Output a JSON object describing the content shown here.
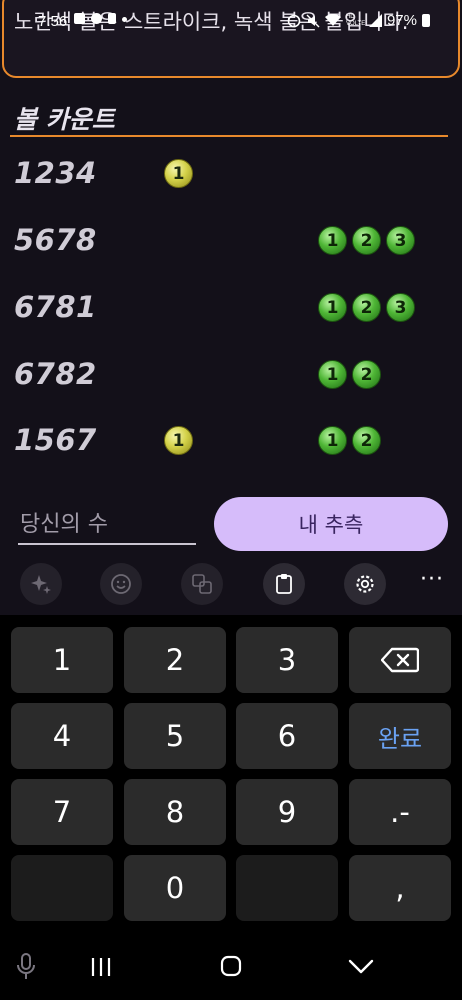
{
  "status_bar": {
    "time": "7:56",
    "signal_text": "HD VOLTE",
    "battery": "97%"
  },
  "hint": {
    "text": "노란색 볼은 스트라이크, 녹색 볼은 볼입니다."
  },
  "section": {
    "title": "볼 카운트"
  },
  "rows": [
    {
      "number": "1234",
      "yellow": [
        "1"
      ],
      "green": []
    },
    {
      "number": "5678",
      "yellow": [],
      "green": [
        "1",
        "2",
        "3"
      ]
    },
    {
      "number": "6781",
      "yellow": [],
      "green": [
        "1",
        "2",
        "3"
      ]
    },
    {
      "number": "6782",
      "yellow": [],
      "green": [
        "1",
        "2"
      ]
    },
    {
      "number": "1567",
      "yellow": [
        "1"
      ],
      "green": [
        "1",
        "2"
      ]
    }
  ],
  "input": {
    "placeholder": "당신의 수",
    "value": ""
  },
  "button": {
    "label": "내 추측"
  },
  "keyboard": {
    "toolbar_icons": [
      "sparkle-icon",
      "emoji-icon",
      "translate-icon",
      "clipboard-icon",
      "gear-icon",
      "more-icon"
    ],
    "more_label": "···",
    "keys": {
      "k1": "1",
      "k2": "2",
      "k3": "3",
      "backspace": "⌫",
      "k4": "4",
      "k5": "5",
      "k6": "6",
      "done": "완료",
      "k7": "7",
      "k8": "8",
      "k9": "9",
      "dot_dash": ".-",
      "k0": "0",
      "comma": ","
    }
  },
  "colors": {
    "accent": "#e8892c",
    "button_bg": "#d6bcfa",
    "strike_ball": "#d4d24a",
    "ball_ball": "#4fb636"
  }
}
